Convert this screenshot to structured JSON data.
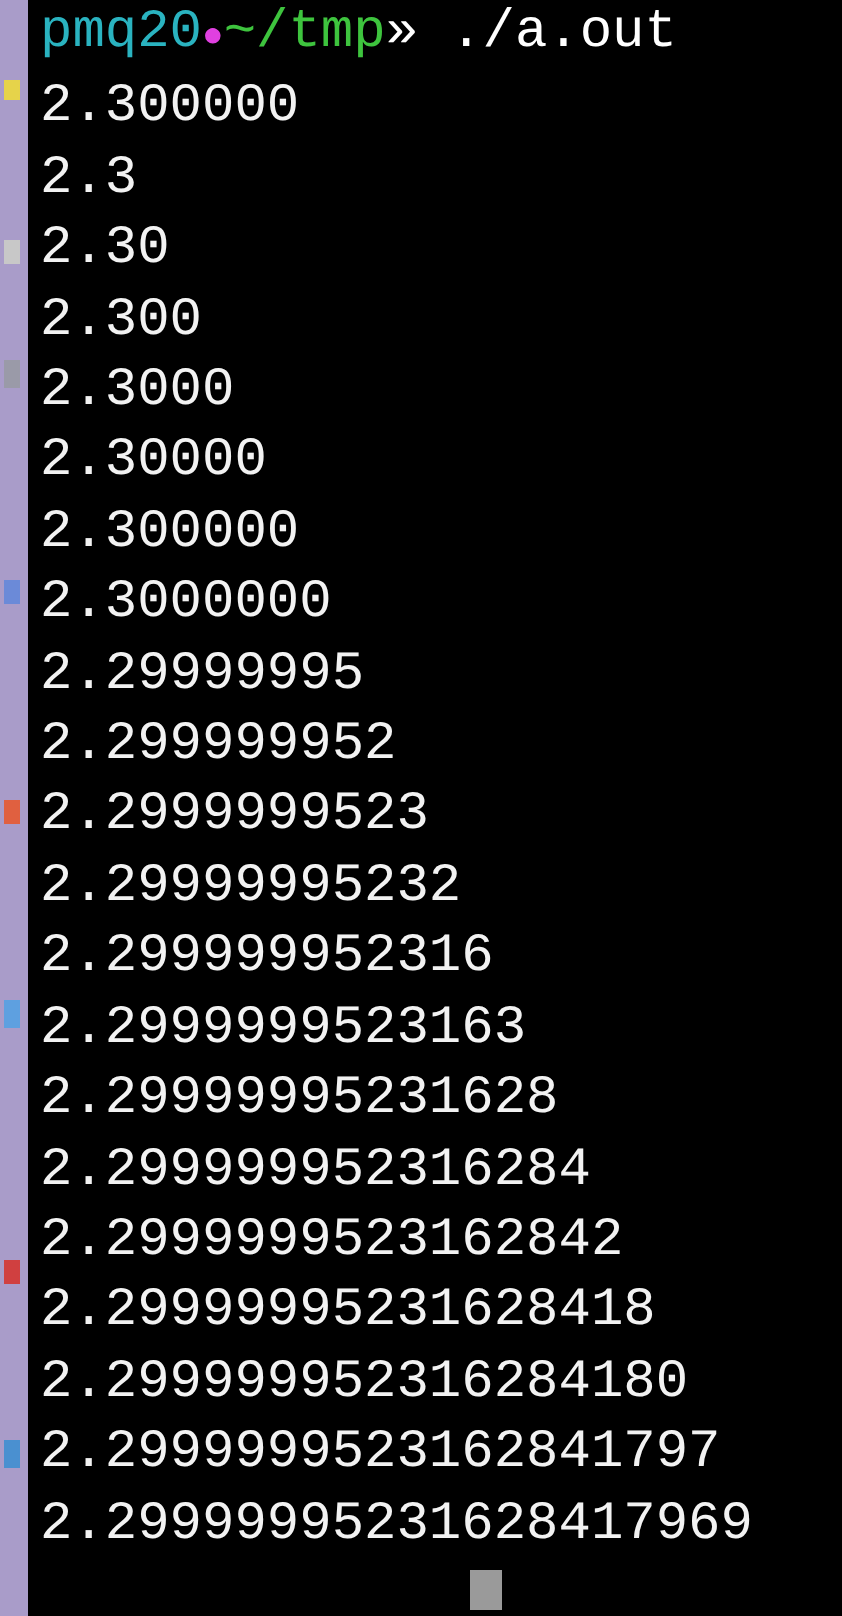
{
  "prompt": {
    "user": "pmq20",
    "separator": "●",
    "path": "~/tmp",
    "arrow": "»",
    "command": "./a.out"
  },
  "output": [
    "2.300000",
    "2.3",
    "2.30",
    "2.300",
    "2.3000",
    "2.30000",
    "2.300000",
    "2.3000000",
    "2.29999995",
    "2.299999952",
    "2.2999999523",
    "2.29999995232",
    "2.299999952316",
    "2.2999999523163",
    "2.29999995231628",
    "2.299999952316284",
    "2.2999999523162842",
    "2.29999995231628418",
    "2.299999952316284180",
    "2.2999999523162841797",
    "2.29999995231628417969"
  ],
  "cursor": {
    "visible": true
  }
}
